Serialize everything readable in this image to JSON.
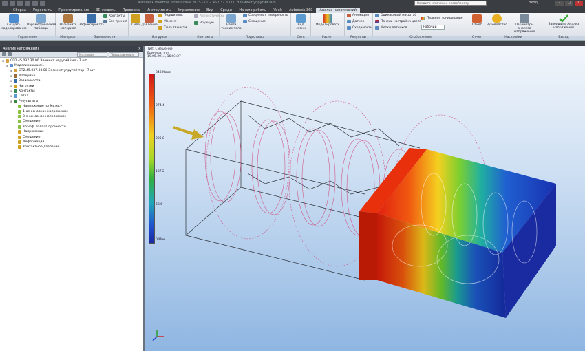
{
  "titlebar": {
    "title": "Autodesk Inventor Professional 2015 - СП2.45.037.30.00 Элемент упругий.iam",
    "search_placeholder": "Введите ключевое слово/фразу",
    "login": "Вход"
  },
  "tabs": [
    {
      "label": "Сборка",
      "active": false
    },
    {
      "label": "Упростить",
      "active": false
    },
    {
      "label": "Проектирование",
      "active": false
    },
    {
      "label": "3D-модель",
      "active": false
    },
    {
      "label": "Проверка",
      "active": false
    },
    {
      "label": "Инструменты",
      "active": false
    },
    {
      "label": "Управление",
      "active": false
    },
    {
      "label": "Вид",
      "active": false
    },
    {
      "label": "Среды",
      "active": false
    },
    {
      "label": "Начало работы",
      "active": false
    },
    {
      "label": "Vault",
      "active": false
    },
    {
      "label": "Autodesk 360",
      "active": false
    },
    {
      "label": "Анализ напряжений",
      "active": true
    }
  ],
  "ribbon": {
    "create_sim": "Создать моделирование",
    "param_table": "Параметрическая таблица",
    "assign_material": "Назначить материал",
    "convert_fixed": "Зафиксировать",
    "contacts": "Контакты",
    "no_friction": "Без трения",
    "force": "Сила",
    "pressure": "Давление",
    "bearing": "Подшипник",
    "moment": "Момент",
    "gravity": "Сила тяжести",
    "auto": "Автоматически",
    "manual": "Вручную",
    "find_thin": "Найти тонкие тела",
    "mid_surface": "Срединная поверхность",
    "offset": "Смещение",
    "mesh_view": "Вид сетки",
    "simulate": "Моделировать",
    "animation": "Анимация",
    "probe": "Датчик",
    "convergence": "Сходимость",
    "same_scale": "Одинаковый масштаб",
    "color_bar": "Панель настройки цвета",
    "probe_labels": "Метки датчиков",
    "smooth_shading": "Плавное тонирование",
    "display_mode": "Рабочий",
    "report": "Отчет",
    "guide": "Руководство",
    "settings": "Параметры анализа напряжений",
    "finish": "Завершить Анализ напряжений"
  },
  "group_labels": [
    "Управление",
    "Материал",
    "Зависимости",
    "Нагрузки",
    "Контакты",
    "Подготовка",
    "Сеть",
    "Расчет",
    "Результат",
    "Отображение",
    "Отчет",
    "Настройки",
    "Выход"
  ],
  "panel": {
    "title": "Анализ напряжения",
    "close": "×",
    "filter_label": "Материал",
    "display_label": "Представления"
  },
  "tree": [
    {
      "label": "СП2.45.037.30.00 Элемент упругий.iam - 7 шт",
      "level": 0,
      "color": "#d8a040"
    },
    {
      "label": "Моделирование:1",
      "level": 1,
      "color": "#5a8fd0"
    },
    {
      "label": "СП2.45.037.30.00 Элемент упругий тор - 7 шт",
      "level": 2,
      "color": "#d8a040"
    },
    {
      "label": "Материал",
      "level": 2,
      "color": "#9a6b3a"
    },
    {
      "label": "Зависимости",
      "level": 2,
      "color": "#3a6ea8"
    },
    {
      "label": "Нагрузки",
      "level": 2,
      "color": "#d0a020"
    },
    {
      "label": "Контакты",
      "level": 2,
      "color": "#3a8a5a"
    },
    {
      "label": "Сетка",
      "level": 2,
      "color": "#5a9ad0"
    },
    {
      "label": "Результаты",
      "level": 2,
      "color": "#3a8a3a"
    },
    {
      "label": "Напряжение по Мизесу",
      "level": 3,
      "color": "#8ac040"
    },
    {
      "label": "1-ое основное напряжение",
      "level": 3,
      "color": "#8ac040"
    },
    {
      "label": "3-е основное напряжение",
      "level": 3,
      "color": "#8ac040"
    },
    {
      "label": "Смещение",
      "level": 3,
      "color": "#8ac040"
    },
    {
      "label": "Коэфф. запаса прочности",
      "level": 3,
      "color": "#8ac040"
    },
    {
      "label": "Напряжение",
      "level": 3,
      "color": "#d0a020"
    },
    {
      "label": "Смещение",
      "level": 3,
      "color": "#d0a020"
    },
    {
      "label": "Деформация",
      "level": 3,
      "color": "#d0a020"
    },
    {
      "label": "Контактное давление",
      "level": 3,
      "color": "#d0a020"
    }
  ],
  "viewport": {
    "info_type": "Тип: Смещение",
    "info_unit": "Единица: mm",
    "info_date": "19.05.2014, 16:03:27",
    "legend_max": "343 Макс",
    "legend_vals": [
      "274,4",
      "205,8",
      "137,2",
      "68,6"
    ],
    "legend_min": "0 Мин"
  },
  "colors": {
    "accent": "#2d6db5",
    "finish_check": "#38a838",
    "mesh_wire": "#d05a8a",
    "load_arrow": "#c8a828"
  }
}
